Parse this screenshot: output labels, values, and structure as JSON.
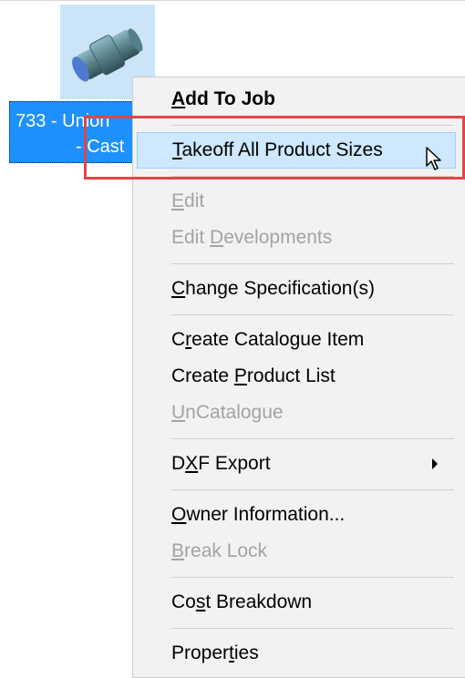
{
  "item": {
    "id_line": "733 - Union",
    "type_line": "- Cast",
    "thumbnail_icon": "cast-union-pipe-fitting-icon"
  },
  "context_menu": {
    "items": [
      {
        "id": "add-to-job",
        "label_pre": "",
        "accel": "A",
        "label_post": "dd To Job",
        "state": "enabled",
        "bold": true
      },
      {
        "id": "takeoff-all-product-sizes",
        "label_pre": "",
        "accel": "T",
        "label_post": "akeoff All Product Sizes",
        "state": "hover"
      },
      {
        "id": "edit",
        "label_pre": "",
        "accel": "E",
        "label_post": "dit",
        "state": "disabled"
      },
      {
        "id": "edit-developments",
        "label_pre": "Edit ",
        "accel": "D",
        "label_post": "evelopments",
        "state": "disabled"
      },
      {
        "id": "change-specification",
        "label_pre": "",
        "accel": "C",
        "label_post": "hange Specification(s)",
        "state": "enabled"
      },
      {
        "id": "create-catalogue-item",
        "label_pre": "C",
        "accel": "r",
        "label_post": "eate Catalogue Item",
        "state": "enabled"
      },
      {
        "id": "create-product-list",
        "label_pre": "Create ",
        "accel": "P",
        "label_post": "roduct List",
        "state": "enabled"
      },
      {
        "id": "uncatalogue",
        "label_pre": "",
        "accel": "U",
        "label_post": "nCatalogue",
        "state": "disabled"
      },
      {
        "id": "dxf-export",
        "label_pre": "D",
        "accel": "X",
        "label_post": "F Export",
        "state": "enabled",
        "submenu": true
      },
      {
        "id": "owner-information",
        "label_pre": "",
        "accel": "O",
        "label_post": "wner Information...",
        "state": "enabled"
      },
      {
        "id": "break-lock",
        "label_pre": "",
        "accel": "B",
        "label_post": "reak Lock",
        "state": "disabled"
      },
      {
        "id": "cost-breakdown",
        "label_pre": "Co",
        "accel": "s",
        "label_post": "t Breakdown",
        "state": "enabled"
      },
      {
        "id": "properties",
        "label_pre": "Proper",
        "accel": "t",
        "label_post": "ies",
        "state": "enabled"
      }
    ],
    "submenu_icon": "chevron-right-icon"
  },
  "annotation": {
    "color": "#e04646"
  },
  "cursor": {
    "icon": "mouse-pointer-icon"
  }
}
